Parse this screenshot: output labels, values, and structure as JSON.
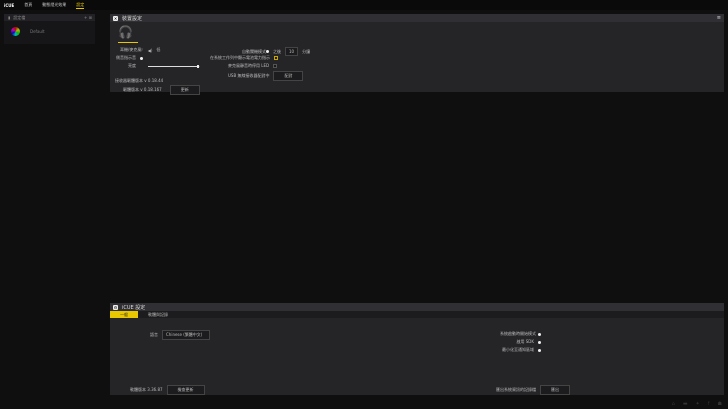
{
  "nav": {
    "logo": "iCUE",
    "items": [
      "首頁",
      "動態燈光效果",
      "設定"
    ],
    "active": 2
  },
  "profiles": {
    "title": "設定檔",
    "add": "+ ⊞",
    "items": [
      "Default"
    ]
  },
  "device": {
    "title": "裝置設定",
    "left": {
      "mic_label": "耳機/麥克風",
      "mic_value": "低",
      "notice_label": "側音指示音",
      "brightness_label": "亮度",
      "brightness": 0.95,
      "receiver_fw": "接收器韌體版本 v 0.18.44",
      "fw": "韌體版本 v 0.18.167",
      "update": "更新"
    },
    "right": {
      "sleep_label": "自動關機模式",
      "after": "之後",
      "minutes": "10",
      "unit": "分鐘",
      "battery_label": "在系統工作列中顯示電池電力指示",
      "led_label": "麥克風靜音時停用 LED",
      "pair_label": "USB 無線接收器配對中",
      "pair_button": "配對"
    }
  },
  "icue": {
    "title": "iCUE 設定",
    "tabs": [
      "一般",
      "軟體與記錄"
    ],
    "language_label": "語言",
    "language": "Chinese (繁體中文)",
    "version": "軟體版本 3.36.87",
    "check": "檢查更新",
    "options": [
      "系統啟動時開始模式",
      "啟用 SDK",
      "最小化至通知區域"
    ],
    "export_label": "匯出系統資訊的記錄檔",
    "export": "匯出"
  }
}
